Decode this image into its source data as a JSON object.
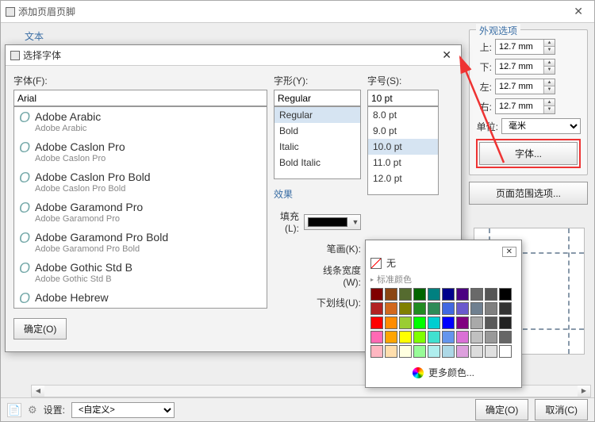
{
  "main": {
    "title": "添加页眉页脚"
  },
  "text_tab": "文本",
  "font_dialog": {
    "title": "选择字体",
    "font_label": "字体(F):",
    "style_label": "字形(Y):",
    "size_label": "字号(S):",
    "font_value": "Arial",
    "style_value": "Regular",
    "size_value": "10 pt",
    "style_list": [
      "Regular",
      "Bold",
      "Italic",
      "Bold Italic"
    ],
    "size_list": [
      "8.0 pt",
      "9.0 pt",
      "10.0 pt",
      "11.0 pt",
      "12.0 pt"
    ],
    "font_list": [
      {
        "display": "Adobe Arabic",
        "sub": "Adobe Arabic"
      },
      {
        "display": "Adobe Caslon Pro",
        "sub": "Adobe Caslon Pro"
      },
      {
        "display": "Adobe Caslon Pro Bold",
        "sub": "Adobe Caslon Pro Bold"
      },
      {
        "display": "Adobe Garamond Pro",
        "sub": "Adobe Garamond Pro"
      },
      {
        "display": "Adobe Garamond Pro Bold",
        "sub": "Adobe Garamond Pro Bold"
      },
      {
        "display": "Adobe Gothic Std B",
        "sub": "Adobe Gothic Std B"
      },
      {
        "display": "Adobe Hebrew",
        "sub": ""
      }
    ],
    "effects_label": "效果",
    "fill_label": "填充(L):",
    "stroke_label": "笔画(K):",
    "line_weight_label": "线条宽度(W):",
    "underline_label": "下划线(U):",
    "ok_label": "确定(O)"
  },
  "color_popup": {
    "none_label": "无",
    "standard_label": "标准颜色",
    "more_label": "更多颜色...",
    "colors": [
      "#800000",
      "#8b4513",
      "#556b2f",
      "#006400",
      "#008080",
      "#00008b",
      "#4b0082",
      "#696969",
      "#555555",
      "#000000",
      "#b22222",
      "#d2691e",
      "#808000",
      "#228b22",
      "#2e8b57",
      "#4169e1",
      "#6a5acd",
      "#708090",
      "#808080",
      "#333333",
      "#ff0000",
      "#ff8c00",
      "#9acd32",
      "#00ff00",
      "#00ced1",
      "#0000ff",
      "#800080",
      "#a9a9a9",
      "#595959",
      "#222222",
      "#ff69b4",
      "#ffa500",
      "#ffff00",
      "#7fff00",
      "#40e0d0",
      "#6495ed",
      "#da70d6",
      "#c0c0c0",
      "#999999",
      "#666666",
      "#ffb6c1",
      "#ffdead",
      "#ffffe0",
      "#98fb98",
      "#afeeee",
      "#add8e6",
      "#dda0dd",
      "#dcdcdc",
      "#e0e0e0",
      "#ffffff"
    ]
  },
  "appearance": {
    "title": "外观选项",
    "top_label": "上:",
    "bottom_label": "下:",
    "left_label": "左:",
    "right_label": "右:",
    "unit_label": "单位:",
    "top": "12.7 mm",
    "bottom": "12.7 mm",
    "left": "12.7 mm",
    "right": "12.7 mm",
    "unit_value": "毫米",
    "font_btn": "字体...",
    "page_range_btn": "页面范围选项..."
  },
  "footer": {
    "settings_label": "设置:",
    "settings_value": "<自定义>",
    "ok": "确定(O)",
    "cancel": "取消(C)"
  }
}
